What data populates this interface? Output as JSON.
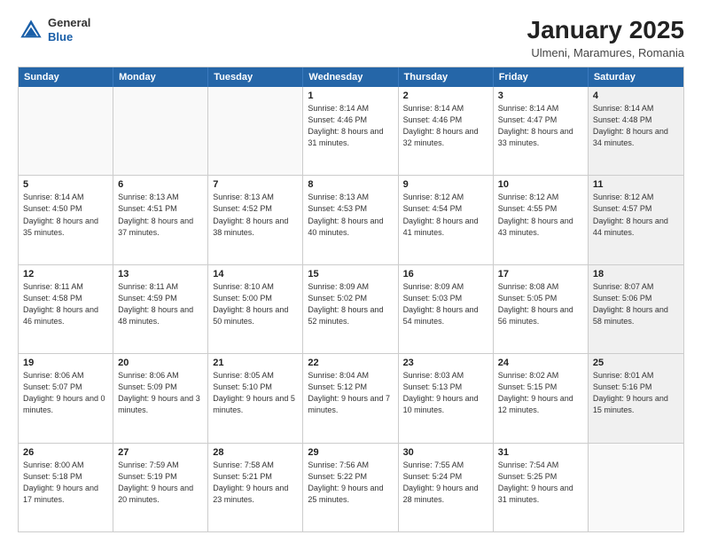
{
  "header": {
    "logo": {
      "general": "General",
      "blue": "Blue"
    },
    "title": "January 2025",
    "subtitle": "Ulmeni, Maramures, Romania"
  },
  "calendar": {
    "days_of_week": [
      "Sunday",
      "Monday",
      "Tuesday",
      "Wednesday",
      "Thursday",
      "Friday",
      "Saturday"
    ],
    "weeks": [
      [
        {
          "day": "",
          "info": "",
          "empty": true
        },
        {
          "day": "",
          "info": "",
          "empty": true
        },
        {
          "day": "",
          "info": "",
          "empty": true
        },
        {
          "day": "1",
          "info": "Sunrise: 8:14 AM\nSunset: 4:46 PM\nDaylight: 8 hours and 31 minutes."
        },
        {
          "day": "2",
          "info": "Sunrise: 8:14 AM\nSunset: 4:46 PM\nDaylight: 8 hours and 32 minutes."
        },
        {
          "day": "3",
          "info": "Sunrise: 8:14 AM\nSunset: 4:47 PM\nDaylight: 8 hours and 33 minutes."
        },
        {
          "day": "4",
          "info": "Sunrise: 8:14 AM\nSunset: 4:48 PM\nDaylight: 8 hours and 34 minutes.",
          "shaded": true
        }
      ],
      [
        {
          "day": "5",
          "info": "Sunrise: 8:14 AM\nSunset: 4:50 PM\nDaylight: 8 hours and 35 minutes."
        },
        {
          "day": "6",
          "info": "Sunrise: 8:13 AM\nSunset: 4:51 PM\nDaylight: 8 hours and 37 minutes."
        },
        {
          "day": "7",
          "info": "Sunrise: 8:13 AM\nSunset: 4:52 PM\nDaylight: 8 hours and 38 minutes."
        },
        {
          "day": "8",
          "info": "Sunrise: 8:13 AM\nSunset: 4:53 PM\nDaylight: 8 hours and 40 minutes."
        },
        {
          "day": "9",
          "info": "Sunrise: 8:12 AM\nSunset: 4:54 PM\nDaylight: 8 hours and 41 minutes."
        },
        {
          "day": "10",
          "info": "Sunrise: 8:12 AM\nSunset: 4:55 PM\nDaylight: 8 hours and 43 minutes."
        },
        {
          "day": "11",
          "info": "Sunrise: 8:12 AM\nSunset: 4:57 PM\nDaylight: 8 hours and 44 minutes.",
          "shaded": true
        }
      ],
      [
        {
          "day": "12",
          "info": "Sunrise: 8:11 AM\nSunset: 4:58 PM\nDaylight: 8 hours and 46 minutes."
        },
        {
          "day": "13",
          "info": "Sunrise: 8:11 AM\nSunset: 4:59 PM\nDaylight: 8 hours and 48 minutes."
        },
        {
          "day": "14",
          "info": "Sunrise: 8:10 AM\nSunset: 5:00 PM\nDaylight: 8 hours and 50 minutes."
        },
        {
          "day": "15",
          "info": "Sunrise: 8:09 AM\nSunset: 5:02 PM\nDaylight: 8 hours and 52 minutes."
        },
        {
          "day": "16",
          "info": "Sunrise: 8:09 AM\nSunset: 5:03 PM\nDaylight: 8 hours and 54 minutes."
        },
        {
          "day": "17",
          "info": "Sunrise: 8:08 AM\nSunset: 5:05 PM\nDaylight: 8 hours and 56 minutes."
        },
        {
          "day": "18",
          "info": "Sunrise: 8:07 AM\nSunset: 5:06 PM\nDaylight: 8 hours and 58 minutes.",
          "shaded": true
        }
      ],
      [
        {
          "day": "19",
          "info": "Sunrise: 8:06 AM\nSunset: 5:07 PM\nDaylight: 9 hours and 0 minutes."
        },
        {
          "day": "20",
          "info": "Sunrise: 8:06 AM\nSunset: 5:09 PM\nDaylight: 9 hours and 3 minutes."
        },
        {
          "day": "21",
          "info": "Sunrise: 8:05 AM\nSunset: 5:10 PM\nDaylight: 9 hours and 5 minutes."
        },
        {
          "day": "22",
          "info": "Sunrise: 8:04 AM\nSunset: 5:12 PM\nDaylight: 9 hours and 7 minutes."
        },
        {
          "day": "23",
          "info": "Sunrise: 8:03 AM\nSunset: 5:13 PM\nDaylight: 9 hours and 10 minutes."
        },
        {
          "day": "24",
          "info": "Sunrise: 8:02 AM\nSunset: 5:15 PM\nDaylight: 9 hours and 12 minutes."
        },
        {
          "day": "25",
          "info": "Sunrise: 8:01 AM\nSunset: 5:16 PM\nDaylight: 9 hours and 15 minutes.",
          "shaded": true
        }
      ],
      [
        {
          "day": "26",
          "info": "Sunrise: 8:00 AM\nSunset: 5:18 PM\nDaylight: 9 hours and 17 minutes."
        },
        {
          "day": "27",
          "info": "Sunrise: 7:59 AM\nSunset: 5:19 PM\nDaylight: 9 hours and 20 minutes."
        },
        {
          "day": "28",
          "info": "Sunrise: 7:58 AM\nSunset: 5:21 PM\nDaylight: 9 hours and 23 minutes."
        },
        {
          "day": "29",
          "info": "Sunrise: 7:56 AM\nSunset: 5:22 PM\nDaylight: 9 hours and 25 minutes."
        },
        {
          "day": "30",
          "info": "Sunrise: 7:55 AM\nSunset: 5:24 PM\nDaylight: 9 hours and 28 minutes."
        },
        {
          "day": "31",
          "info": "Sunrise: 7:54 AM\nSunset: 5:25 PM\nDaylight: 9 hours and 31 minutes."
        },
        {
          "day": "",
          "info": "",
          "empty": true,
          "shaded": true
        }
      ]
    ]
  }
}
